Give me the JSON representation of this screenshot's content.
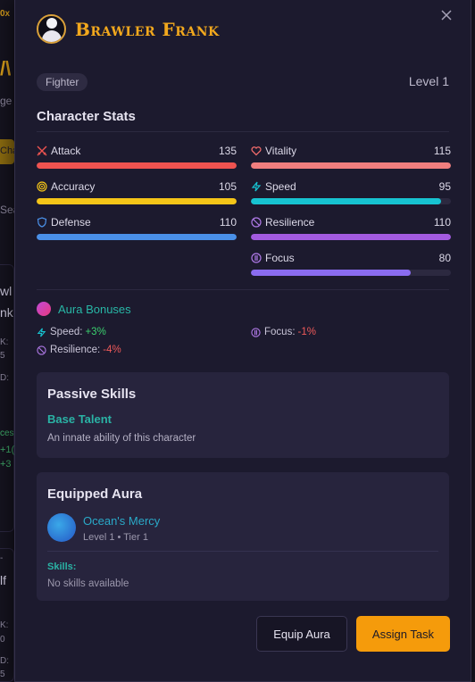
{
  "background_fragments": {
    "f1": "/\\",
    "f2": "ge",
    "f3": "Cha",
    "f4": "Sea",
    "f5": "wl",
    "f6": "nk",
    "f7": "K:",
    "f8": "5",
    "f9": "D:",
    "f10": "ces",
    "f11": "+1(",
    "f12": "+3",
    "f13": "-",
    "f14": "lf",
    "f15": "K:",
    "f16": "0",
    "f17": "D:",
    "f18": "5",
    "f0": "0x"
  },
  "modal": {
    "close_label": "×",
    "character_name": "Brawler Frank",
    "class_badge": "Fighter",
    "level": "Level 1",
    "stats_title": "Character Stats",
    "stats": [
      {
        "name": "Attack",
        "value": "135",
        "fill": 1.0,
        "color": "#ef5350",
        "icon": "swords-icon"
      },
      {
        "name": "Vitality",
        "value": "115",
        "fill": 1.0,
        "color": "#f07e7e",
        "icon": "heart-icon"
      },
      {
        "name": "Accuracy",
        "value": "105",
        "fill": 1.0,
        "color": "#f5c518",
        "icon": "target-icon"
      },
      {
        "name": "Speed",
        "value": "95",
        "fill": 0.95,
        "color": "#17c3d1",
        "icon": "lightning-icon"
      },
      {
        "name": "Defense",
        "value": "110",
        "fill": 1.0,
        "color": "#4a90e8",
        "icon": "shield-icon"
      },
      {
        "name": "Resilience",
        "value": "110",
        "fill": 1.0,
        "color": "#a35be0",
        "icon": "resilience-icon"
      },
      {
        "name": "Focus",
        "value": "80",
        "fill": 0.8,
        "color": "#8a6cf0",
        "icon": "focus-icon"
      }
    ],
    "aura_bonuses_title": "Aura Bonuses",
    "bonuses": [
      {
        "stat": "Speed:",
        "value": "+3%",
        "icon": "lightning-icon"
      },
      {
        "stat": "Focus:",
        "value": "-1%",
        "icon": "focus-icon"
      },
      {
        "stat": "Resilience:",
        "value": "-4%",
        "icon": "resilience-icon"
      }
    ],
    "passive": {
      "title": "Passive Skills",
      "talent_name": "Base Talent",
      "talent_desc": "An innate ability of this character"
    },
    "equipped_aura": {
      "title": "Equipped Aura",
      "aura_name": "Ocean's Mercy",
      "aura_meta": "Level 1 • Tier 1",
      "skills_label": "Skills:",
      "skills_value": "No skills available"
    },
    "buttons": {
      "equip": "Equip Aura",
      "assign": "Assign Task"
    }
  }
}
